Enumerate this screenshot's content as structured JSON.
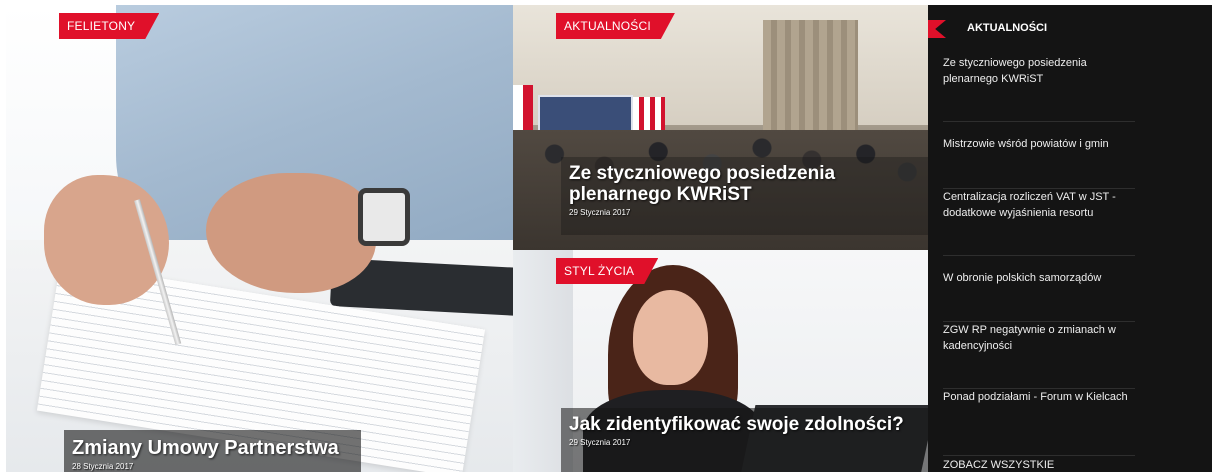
{
  "tiles": {
    "left": {
      "category": "FELIETONY",
      "title": "Zmiany Umowy Partnerstwa",
      "date": "28 Stycznia 2017"
    },
    "top_right": {
      "category": "AKTUALNOŚCI",
      "title": "Ze stycznioweg⁠o posiedzenia plenarnego KWRiST",
      "date": "29 Stycznia 2017"
    },
    "bottom_right": {
      "category": "STYL ŻYCIA",
      "title": "Jak zidentyfikować swoje zdolności?",
      "date": "29 Stycznia 2017"
    }
  },
  "sidebar": {
    "header": "AKTUALNOŚCI",
    "items": [
      {
        "label": "Ze styczniowego posiedzenia plenarnego KWRiST"
      },
      {
        "label": "Mistrzowie wśród powiatów i gmin"
      },
      {
        "label": "Centralizacja rozliczeń VAT w JST - dodatkowe wyjaśnienia resortu"
      },
      {
        "label": "W obronie polskich samorządów"
      },
      {
        "label": "ZGW RP negatywnie o zmianach w kadencyjności"
      },
      {
        "label": "Ponad podziałami - Forum w Kielcach"
      }
    ],
    "see_all": "ZOBACZ WSZYSTKIE"
  },
  "colors": {
    "accent": "#e0102a",
    "sidebar_bg": "#141414",
    "text_light": "#ffffff"
  }
}
